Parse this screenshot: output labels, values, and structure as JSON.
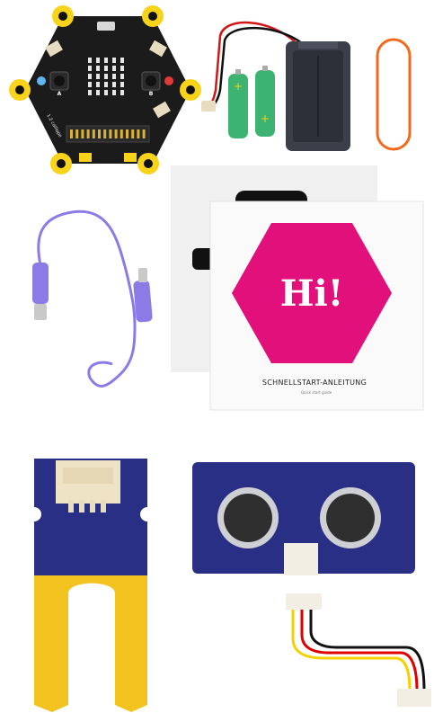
{
  "board": {
    "button_a": "A",
    "button_b": "B",
    "brand": "1.2 calliope"
  },
  "quickstart": {
    "hi_text": "Hi!",
    "title": "SCHNELLSTART-ANLEITUNG",
    "subtitle": "Quick start guide"
  },
  "colors": {
    "board_black": "#1b1b1b",
    "pad_yellow": "#f7d31a",
    "battery_green": "#3cb371",
    "battery_holder": "#3a3f4a",
    "band_orange": "#f26b1d",
    "cable_purple": "#8c7ae6",
    "hi_magenta": "#e2107b",
    "sensor_blue": "#2a2f86",
    "sensor_gold": "#f2c31f",
    "wire_red": "#e10000",
    "wire_yellow": "#f4d000",
    "wire_black": "#111111"
  }
}
